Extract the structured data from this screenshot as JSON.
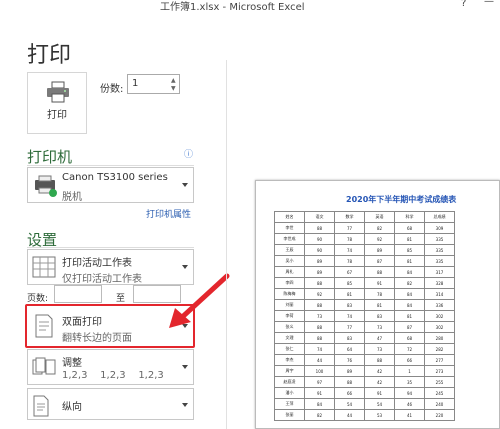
{
  "window": {
    "title": "工作簿1.xlsx - Microsoft Excel",
    "help": "?",
    "minimize": "—"
  },
  "page_title": "打印",
  "print_button": {
    "label": "打印"
  },
  "copies": {
    "label": "份数:",
    "value": "1"
  },
  "printer": {
    "section_title": "打印机",
    "name": "Canon TS3100 series",
    "status": "脱机",
    "properties_link": "打印机属性",
    "info": "ⓘ"
  },
  "settings": {
    "section_title": "设置",
    "scope": {
      "title": "打印活动工作表",
      "subtitle": "仅打印活动工作表"
    },
    "pages": {
      "label": "页数:",
      "to_label": "至",
      "from": "",
      "to": ""
    },
    "duplex": {
      "title": "双面打印",
      "subtitle": "翻转长边的页面"
    },
    "collate": {
      "title": "调整",
      "subtitle": "1,2,3    1,2,3    1,2,3"
    },
    "orientation": {
      "title": "纵向"
    }
  },
  "colors": {
    "accent_green": "#2e6b3a",
    "highlight_red": "#e3262d",
    "link_blue": "#2a5db0"
  },
  "preview": {
    "title": "2020年下半年期中考试成绩表",
    "headers": [
      "姓名",
      "语文",
      "数学",
      "英语",
      "科学",
      "总成绩"
    ],
    "rows": [
      [
        "李世",
        "88",
        "77",
        "82",
        "68",
        "309"
      ],
      [
        "李世成",
        "90",
        "78",
        "92",
        "81",
        "335"
      ],
      [
        "王辰",
        "90",
        "74",
        "89",
        "85",
        "335"
      ],
      [
        "吴小",
        "89",
        "78",
        "87",
        "81",
        "335"
      ],
      [
        "周礼",
        "89",
        "67",
        "88",
        "84",
        "317"
      ],
      [
        "李四",
        "88",
        "85",
        "91",
        "82",
        "328"
      ],
      [
        "陈梅梅",
        "92",
        "81",
        "78",
        "84",
        "314"
      ],
      [
        "刘丽",
        "88",
        "83",
        "81",
        "84",
        "336"
      ],
      [
        "李荷",
        "73",
        "74",
        "83",
        "81",
        "302"
      ],
      [
        "张义",
        "88",
        "77",
        "73",
        "87",
        "302"
      ],
      [
        "文理",
        "88",
        "83",
        "47",
        "68",
        "280"
      ],
      [
        "张仁",
        "74",
        "64",
        "73",
        "72",
        "282"
      ],
      [
        "李杰",
        "44",
        "76",
        "88",
        "66",
        "277"
      ],
      [
        "周宇",
        "100",
        "89",
        "42",
        "1",
        "273"
      ],
      [
        "赵庭凌",
        "97",
        "88",
        "42",
        "35",
        "255"
      ],
      [
        "潘小",
        "91",
        "66",
        "91",
        "94",
        "245"
      ],
      [
        "王萍",
        "84",
        "54",
        "54",
        "46",
        "240"
      ],
      [
        "张丽",
        "82",
        "44",
        "53",
        "41",
        "220"
      ]
    ]
  }
}
